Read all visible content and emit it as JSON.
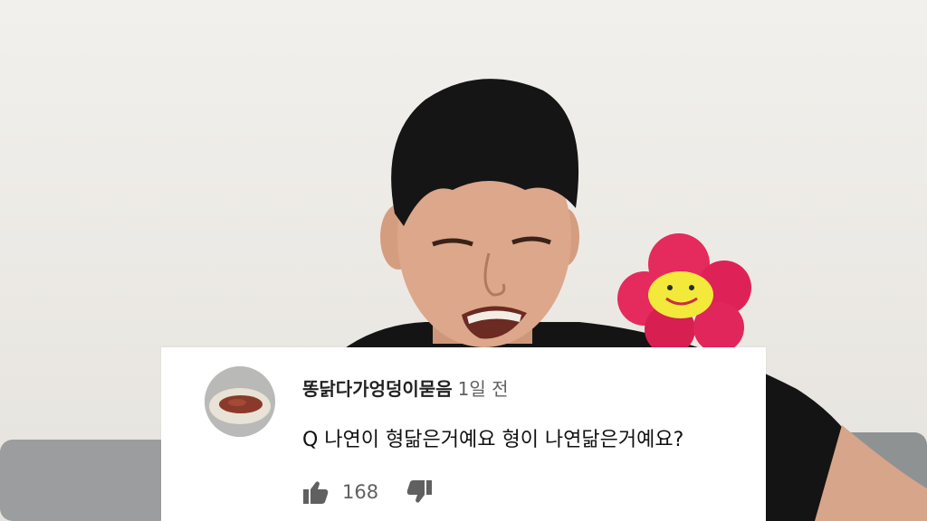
{
  "comment": {
    "author": "똥닭다가엉덩이묻음",
    "time": "1일 전",
    "text": "Q 나연이 형닮은거예요 형이 나연닮은거예요?",
    "likes": "168"
  },
  "icons": {
    "like": "thumbs-up-icon",
    "dislike": "thumbs-down-icon"
  },
  "colors": {
    "wall": "#eeebe6",
    "card": "#ffffff",
    "flower_petals": "#e8245a",
    "flower_face": "#f2e93a"
  }
}
